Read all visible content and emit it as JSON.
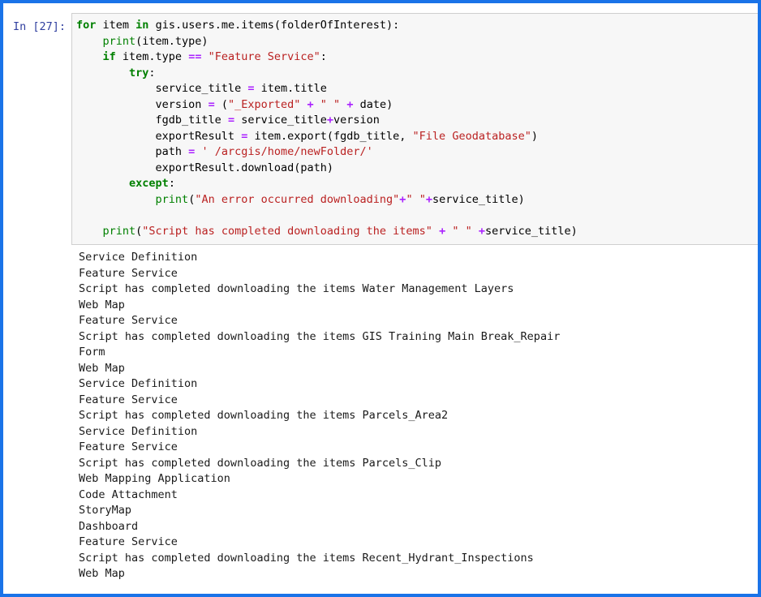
{
  "notebook": {
    "border_color": "#1a73e8",
    "cell_background": "#f7f7f7",
    "prompt_color": "#303F9F"
  },
  "cell": {
    "prompt_label": "In [27]:",
    "code_lines": [
      [
        {
          "t": "for",
          "c": "kw"
        },
        {
          "t": " item ",
          "c": "pl"
        },
        {
          "t": "in",
          "c": "kw"
        },
        {
          "t": " gis.users.me.items(folderOfInterest):",
          "c": "pl"
        }
      ],
      [
        {
          "t": "    ",
          "c": "pl"
        },
        {
          "t": "print",
          "c": "bi"
        },
        {
          "t": "(item.type)",
          "c": "pl"
        }
      ],
      [
        {
          "t": "    ",
          "c": "pl"
        },
        {
          "t": "if",
          "c": "kw"
        },
        {
          "t": " item.type ",
          "c": "pl"
        },
        {
          "t": "==",
          "c": "op"
        },
        {
          "t": " ",
          "c": "pl"
        },
        {
          "t": "\"Feature Service\"",
          "c": "str"
        },
        {
          "t": ":",
          "c": "pl"
        }
      ],
      [
        {
          "t": "        ",
          "c": "pl"
        },
        {
          "t": "try",
          "c": "kw"
        },
        {
          "t": ":",
          "c": "pl"
        }
      ],
      [
        {
          "t": "            service_title ",
          "c": "pl"
        },
        {
          "t": "=",
          "c": "op"
        },
        {
          "t": " item.title",
          "c": "pl"
        }
      ],
      [
        {
          "t": "            version ",
          "c": "pl"
        },
        {
          "t": "=",
          "c": "op"
        },
        {
          "t": " (",
          "c": "pl"
        },
        {
          "t": "\"_Exported\"",
          "c": "str"
        },
        {
          "t": " ",
          "c": "pl"
        },
        {
          "t": "+",
          "c": "op"
        },
        {
          "t": " ",
          "c": "pl"
        },
        {
          "t": "\" \"",
          "c": "str"
        },
        {
          "t": " ",
          "c": "pl"
        },
        {
          "t": "+",
          "c": "op"
        },
        {
          "t": " date)",
          "c": "pl"
        }
      ],
      [
        {
          "t": "            fgdb_title ",
          "c": "pl"
        },
        {
          "t": "=",
          "c": "op"
        },
        {
          "t": " service_title",
          "c": "pl"
        },
        {
          "t": "+",
          "c": "op"
        },
        {
          "t": "version",
          "c": "pl"
        }
      ],
      [
        {
          "t": "            exportResult ",
          "c": "pl"
        },
        {
          "t": "=",
          "c": "op"
        },
        {
          "t": " item.export(fgdb_title, ",
          "c": "pl"
        },
        {
          "t": "\"File Geodatabase\"",
          "c": "str"
        },
        {
          "t": ")",
          "c": "pl"
        }
      ],
      [
        {
          "t": "            path ",
          "c": "pl"
        },
        {
          "t": "=",
          "c": "op"
        },
        {
          "t": " ",
          "c": "pl"
        },
        {
          "t": "' /arcgis/home/newFolder/'",
          "c": "str"
        }
      ],
      [
        {
          "t": "            exportResult.download(path)",
          "c": "pl"
        }
      ],
      [
        {
          "t": "        ",
          "c": "pl"
        },
        {
          "t": "except",
          "c": "kw"
        },
        {
          "t": ":",
          "c": "pl"
        }
      ],
      [
        {
          "t": "            ",
          "c": "pl"
        },
        {
          "t": "print",
          "c": "bi"
        },
        {
          "t": "(",
          "c": "pl"
        },
        {
          "t": "\"An error occurred downloading\"",
          "c": "str"
        },
        {
          "t": "+",
          "c": "op"
        },
        {
          "t": "\" \"",
          "c": "str"
        },
        {
          "t": "+",
          "c": "op"
        },
        {
          "t": "service_title)",
          "c": "pl"
        }
      ],
      [
        {
          "t": "",
          "c": "pl"
        }
      ],
      [
        {
          "t": "    ",
          "c": "pl"
        },
        {
          "t": "print",
          "c": "bi"
        },
        {
          "t": "(",
          "c": "pl"
        },
        {
          "t": "\"Script has completed downloading the items\"",
          "c": "str"
        },
        {
          "t": " ",
          "c": "pl"
        },
        {
          "t": "+",
          "c": "op"
        },
        {
          "t": " ",
          "c": "pl"
        },
        {
          "t": "\" \"",
          "c": "str"
        },
        {
          "t": " ",
          "c": "pl"
        },
        {
          "t": "+",
          "c": "op"
        },
        {
          "t": "service_title)",
          "c": "pl"
        }
      ]
    ]
  },
  "output": {
    "lines": [
      "Service Definition",
      "Feature Service",
      "Script has completed downloading the items Water Management Layers",
      "Web Map",
      "Feature Service",
      "Script has completed downloading the items GIS Training Main Break_Repair",
      "Form",
      "Web Map",
      "Service Definition",
      "Feature Service",
      "Script has completed downloading the items Parcels_Area2",
      "Service Definition",
      "Feature Service",
      "Script has completed downloading the items Parcels_Clip",
      "Web Mapping Application",
      "Code Attachment",
      "StoryMap",
      "Dashboard",
      "Feature Service",
      "Script has completed downloading the items Recent_Hydrant_Inspections",
      "Web Map"
    ]
  }
}
